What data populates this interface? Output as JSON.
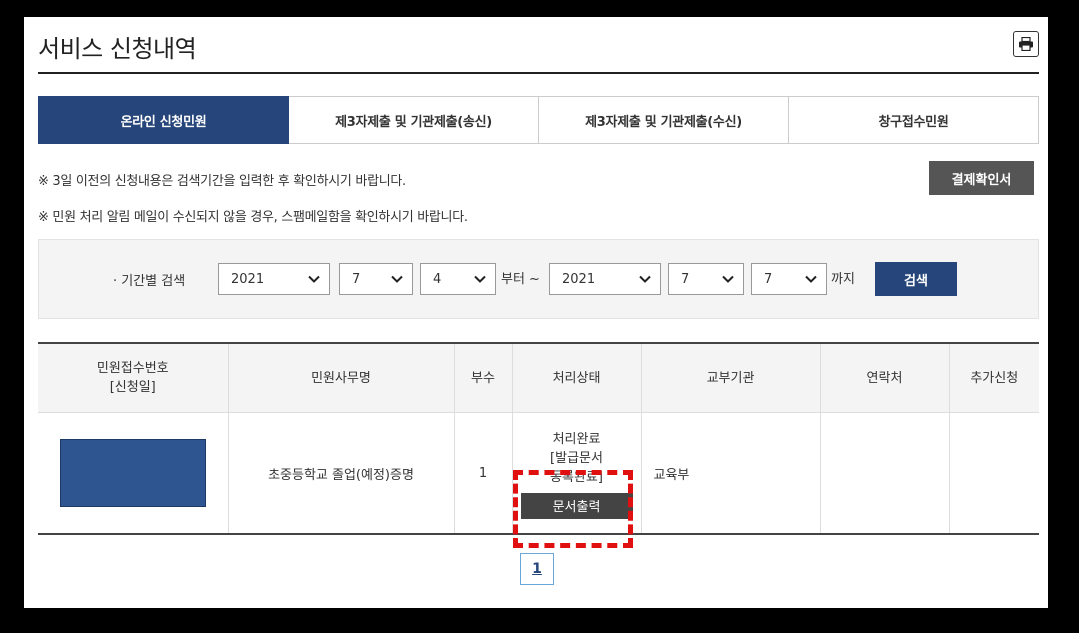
{
  "page": {
    "title": "서비스 신청내역",
    "print_icon": "printer-icon"
  },
  "tabs": [
    {
      "label": "온라인 신청민원",
      "active": true
    },
    {
      "label": "제3자제출 및 기관제출(송신)",
      "active": false
    },
    {
      "label": "제3자제출 및 기관제출(수신)",
      "active": false
    },
    {
      "label": "창구접수민원",
      "active": false
    }
  ],
  "notices": [
    "※ 3일 이전의 신청내용은 검색기간을 입력한 후 확인하시기 바랍니다.",
    "※ 민원 처리 알림 메일이 수신되지 않을 경우, 스팸메일함을 확인하시기 바랍니다."
  ],
  "receipt_button": "결제확인서",
  "search": {
    "label": "· 기간별 검색",
    "from_year": "2021",
    "from_month": "7",
    "from_day": "4",
    "from_suffix": "부터 ~",
    "to_year": "2021",
    "to_month": "7",
    "to_day": "7",
    "to_suffix": "까지",
    "button": "검색"
  },
  "table": {
    "headers": [
      "민원접수번호",
      "[신청일]",
      "민원사무명",
      "부수",
      "처리상태",
      "교부기관",
      "연락처",
      "추가신청"
    ],
    "row": {
      "service_name": "초중등학교 졸업(예정)증명",
      "copies": "1",
      "status_line1": "처리완료",
      "status_line2": "[발급문서",
      "status_line3": "동록완료]",
      "doc_button": "문서출력",
      "agency": "교육부",
      "contact": "",
      "extra": ""
    }
  },
  "pagination": {
    "current": "1"
  },
  "colors": {
    "primary": "#26457a",
    "highlight": "#e01010"
  }
}
